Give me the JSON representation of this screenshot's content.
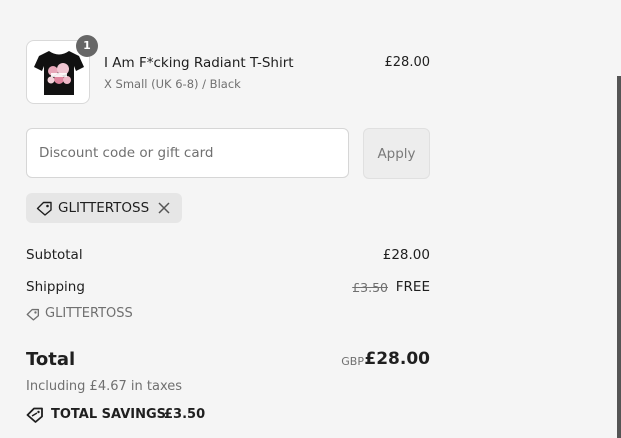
{
  "colors": {
    "background": "#f5f5f5",
    "text": "#1f1f1f",
    "muted": "#707070",
    "badge": "#666666",
    "chip": "#e6e6e6"
  },
  "product": {
    "quantity_badge": "1",
    "title": "I Am F*cking Radiant T-Shirt",
    "variant": "X Small (UK 6-8) / Black",
    "price": "£28.00",
    "image_icon": "tshirt-image"
  },
  "discount": {
    "placeholder": "Discount code or gift card",
    "apply_label": "Apply",
    "applied_code": "GLITTERTOSS",
    "remove_icon": "close-icon"
  },
  "summary": {
    "subtotal_label": "Subtotal",
    "subtotal_value": "£28.00",
    "shipping_label": "Shipping",
    "shipping_original": "£3.50",
    "shipping_value": "FREE",
    "shipping_code": "GLITTERTOSS",
    "total_label": "Total",
    "currency": "GBP",
    "total_value": "£28.00",
    "tax_note": "Including £4.67 in taxes",
    "savings_label": "TOTAL SAVINGS",
    "savings_value": "£3.50"
  }
}
